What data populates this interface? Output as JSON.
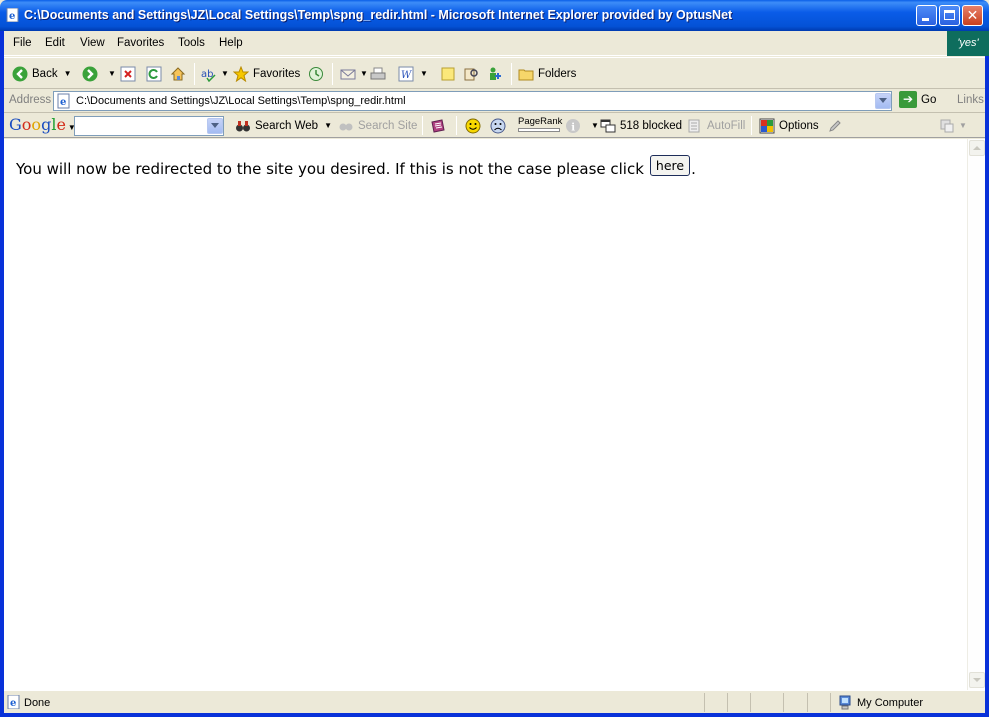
{
  "window": {
    "title": "C:\\Documents and Settings\\JZ\\Local Settings\\Temp\\spng_redir.html - Microsoft Internet Explorer provided by OptusNet",
    "throbber_text": "'yes'"
  },
  "menu": {
    "items": [
      {
        "label": "File"
      },
      {
        "label": "Edit"
      },
      {
        "label": "View"
      },
      {
        "label": "Favorites"
      },
      {
        "label": "Tools"
      },
      {
        "label": "Help"
      }
    ]
  },
  "toolbar": {
    "back_label": "Back",
    "favorites_label": "Favorites",
    "folders_label": "Folders"
  },
  "address": {
    "label": "Address",
    "value": "C:\\Documents and Settings\\JZ\\Local Settings\\Temp\\spng_redir.html",
    "go_label": "Go",
    "links_label": "Links"
  },
  "google_toolbar": {
    "search_web_label": "Search Web",
    "search_site_label": "Search Site",
    "pagerank_label": "PageRank",
    "blocked_label": "518 blocked",
    "autofill_label": "AutoFill",
    "options_label": "Options"
  },
  "content": {
    "message": "You will now be redirected to the site you desired. If this is not the case please click",
    "here_label": "here",
    "trailing": "."
  },
  "status": {
    "text": "Done",
    "zone": "My Computer"
  },
  "colors": {
    "titlebar": "#0a5ce8",
    "frame": "#0831d9",
    "chrome": "#ece9d8"
  }
}
